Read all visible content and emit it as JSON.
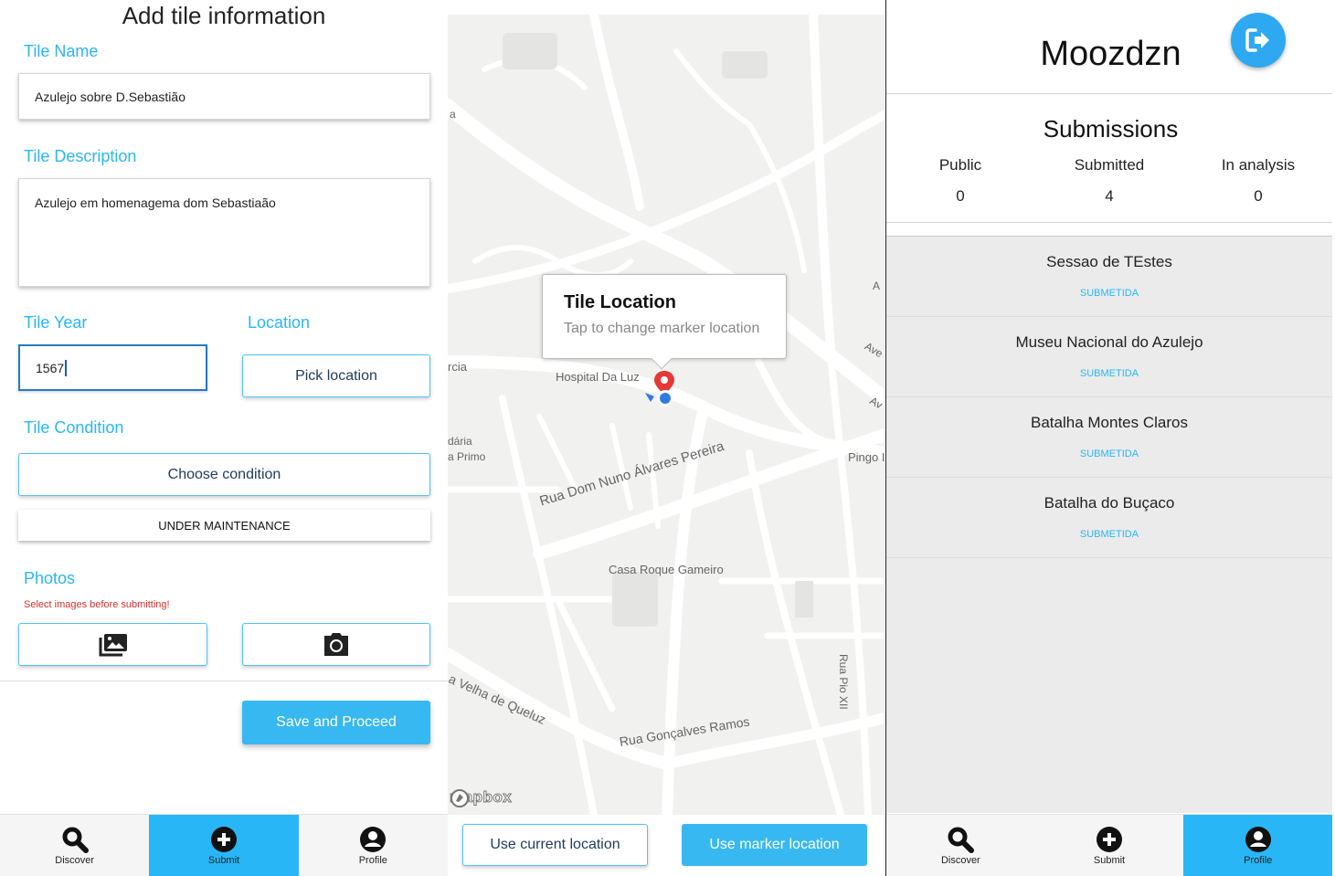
{
  "colors": {
    "accent": "#29b6f6",
    "error": "#d32f2f",
    "marker": "#e53935",
    "location_dot": "#2f7be0"
  },
  "add_tile": {
    "title": "Add tile information",
    "name_label": "Tile Name",
    "name_value": "Azulejo sobre D.Sebastião",
    "description_label": "Tile Description",
    "description_value": "Azulejo em homenagema  dom Sebastiaão",
    "year_label": "Tile Year",
    "year_value": "1567",
    "location_label": "Location",
    "pick_location": "Pick location",
    "condition_label": "Tile Condition",
    "choose_condition": "Choose condition",
    "selected_condition": "UNDER MAINTENANCE",
    "photos_label": "Photos",
    "photos_error": "Select images before submitting!",
    "gallery_icon": "photo-library-icon",
    "camera_icon": "camera-icon",
    "save_button": "Save and Proceed"
  },
  "nav": {
    "discover": "Discover",
    "submit": "Submit",
    "profile": "Profile"
  },
  "map": {
    "popup_title": "Tile Location",
    "popup_subtitle": "Tap to change marker location",
    "labels": {
      "hospital": "Hospital Da Luz",
      "rua_nuno": "Rua Dom Nuno Álvares Pereira",
      "casa": "Casa Roque Gameiro",
      "velha": "a Velha de Queluz",
      "goncalves": "Rua Gonçalves Ramos",
      "pio": "Rua Pio XII",
      "pingo": "Pingo I",
      "rcia": "rcia",
      "daria": "dária",
      "primo": "a Primo",
      "edge_a1": "a",
      "edge_av1": "A",
      "edge_av2": "Ave",
      "edge_av3": "Av"
    },
    "brand": "mapbox",
    "use_current": "Use current location",
    "use_marker": "Use marker location"
  },
  "profile": {
    "username": "Moozdzn",
    "logout_icon": "logout-icon",
    "submissions_title": "Submissions",
    "stats": [
      {
        "label": "Public",
        "value": "0"
      },
      {
        "label": "Submitted",
        "value": "4"
      },
      {
        "label": "In analysis",
        "value": "0"
      }
    ],
    "items": [
      {
        "title": "Sessao de TEstes",
        "status": "SUBMETIDA"
      },
      {
        "title": "Museu Nacional do Azulejo",
        "status": "SUBMETIDA"
      },
      {
        "title": "Batalha Montes Claros",
        "status": "SUBMETIDA"
      },
      {
        "title": "Batalha do Buçaco",
        "status": "SUBMETIDA"
      }
    ]
  }
}
